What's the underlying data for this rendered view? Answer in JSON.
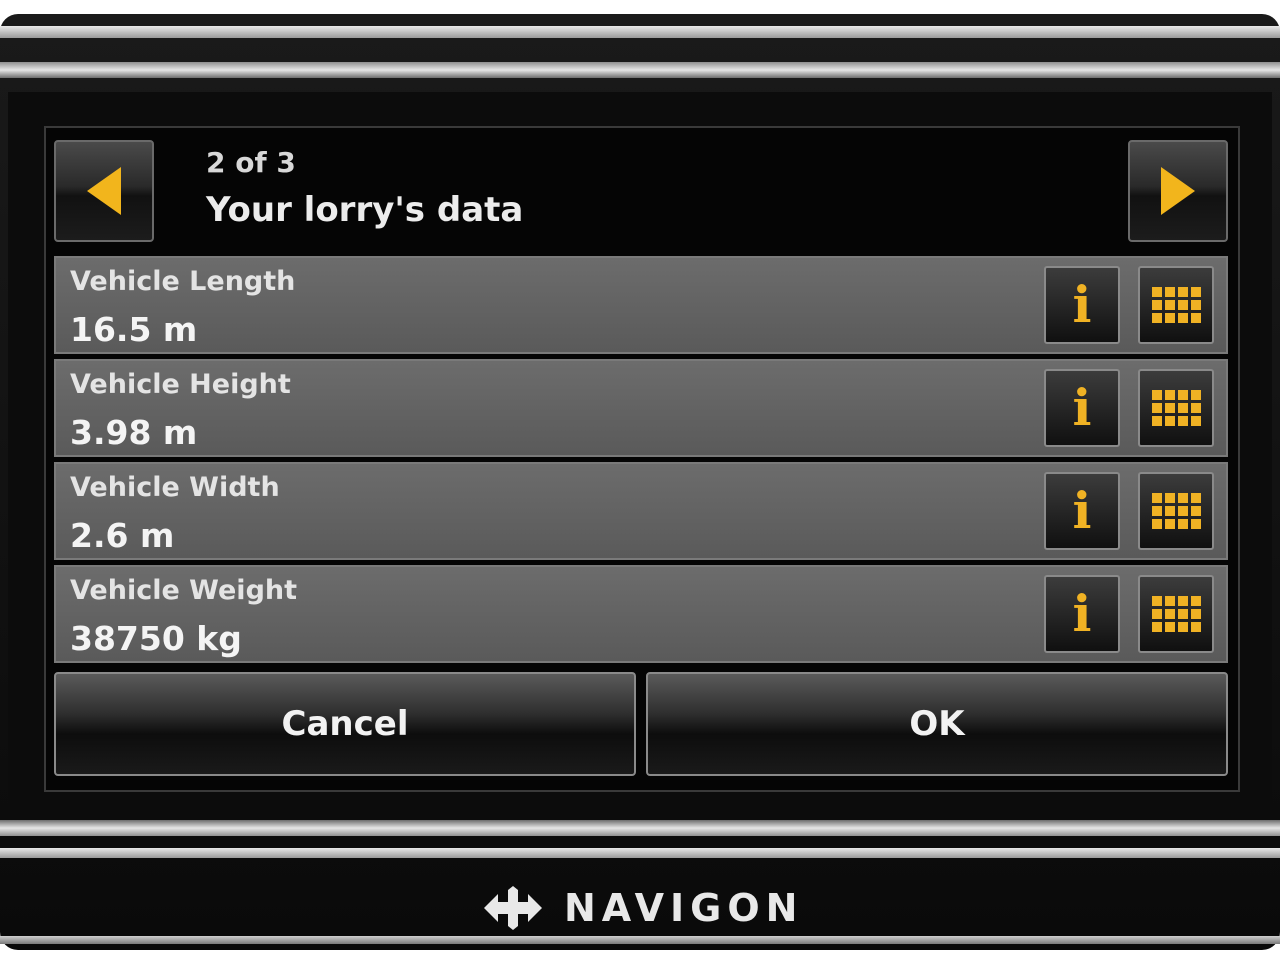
{
  "header": {
    "page_count": "2 of 3",
    "title": "Your lorry's data",
    "prev_icon": "arrow-left-icon",
    "next_icon": "arrow-right-icon",
    "accent_color": "#f2b51c"
  },
  "rows": [
    {
      "label": "Vehicle Length",
      "value": "16.5 m"
    },
    {
      "label": "Vehicle Height",
      "value": "3.98 m"
    },
    {
      "label": "Vehicle Width",
      "value": "2.6 m"
    },
    {
      "label": "Vehicle Weight",
      "value": "38750 kg"
    }
  ],
  "row_buttons": {
    "info_icon": "info-icon",
    "keypad_icon": "keypad-icon"
  },
  "actions": {
    "cancel_label": "Cancel",
    "ok_label": "OK"
  },
  "brand": {
    "name": "NAVIGON"
  }
}
